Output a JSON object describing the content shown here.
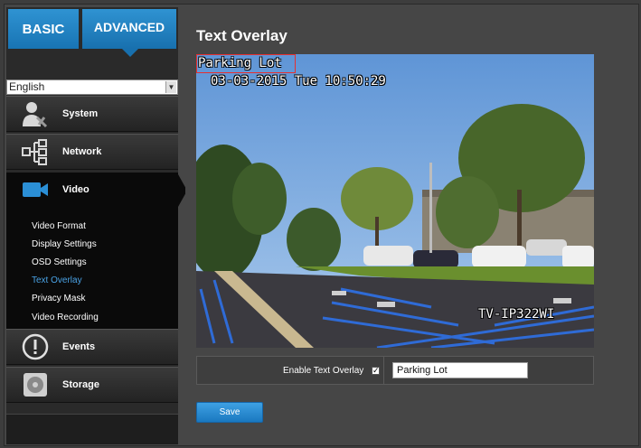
{
  "tabs": {
    "basic": "BASIC",
    "advanced": "ADVANCED"
  },
  "language": {
    "selected": "English"
  },
  "nav": {
    "system": "System",
    "network": "Network",
    "video": "Video",
    "events": "Events",
    "storage": "Storage"
  },
  "video_sub": {
    "format": "Video Format",
    "display": "Display Settings",
    "osd": "OSD Settings",
    "text_overlay": "Text Overlay",
    "privacy": "Privacy Mask",
    "recording": "Video Recording"
  },
  "page": {
    "title": "Text Overlay"
  },
  "camera": {
    "overlay_text": "Parking Lot",
    "datetime": "03-03-2015 Tue 10:50:29",
    "model_label": "TV-IP322WI"
  },
  "form": {
    "enable_label": "Enable Text Overlay",
    "enable_checked": true,
    "text_value": "Parking Lot"
  },
  "buttons": {
    "save": "Save"
  },
  "colors": {
    "accent": "#1f85c9",
    "active_sub": "#4aa3e6"
  }
}
